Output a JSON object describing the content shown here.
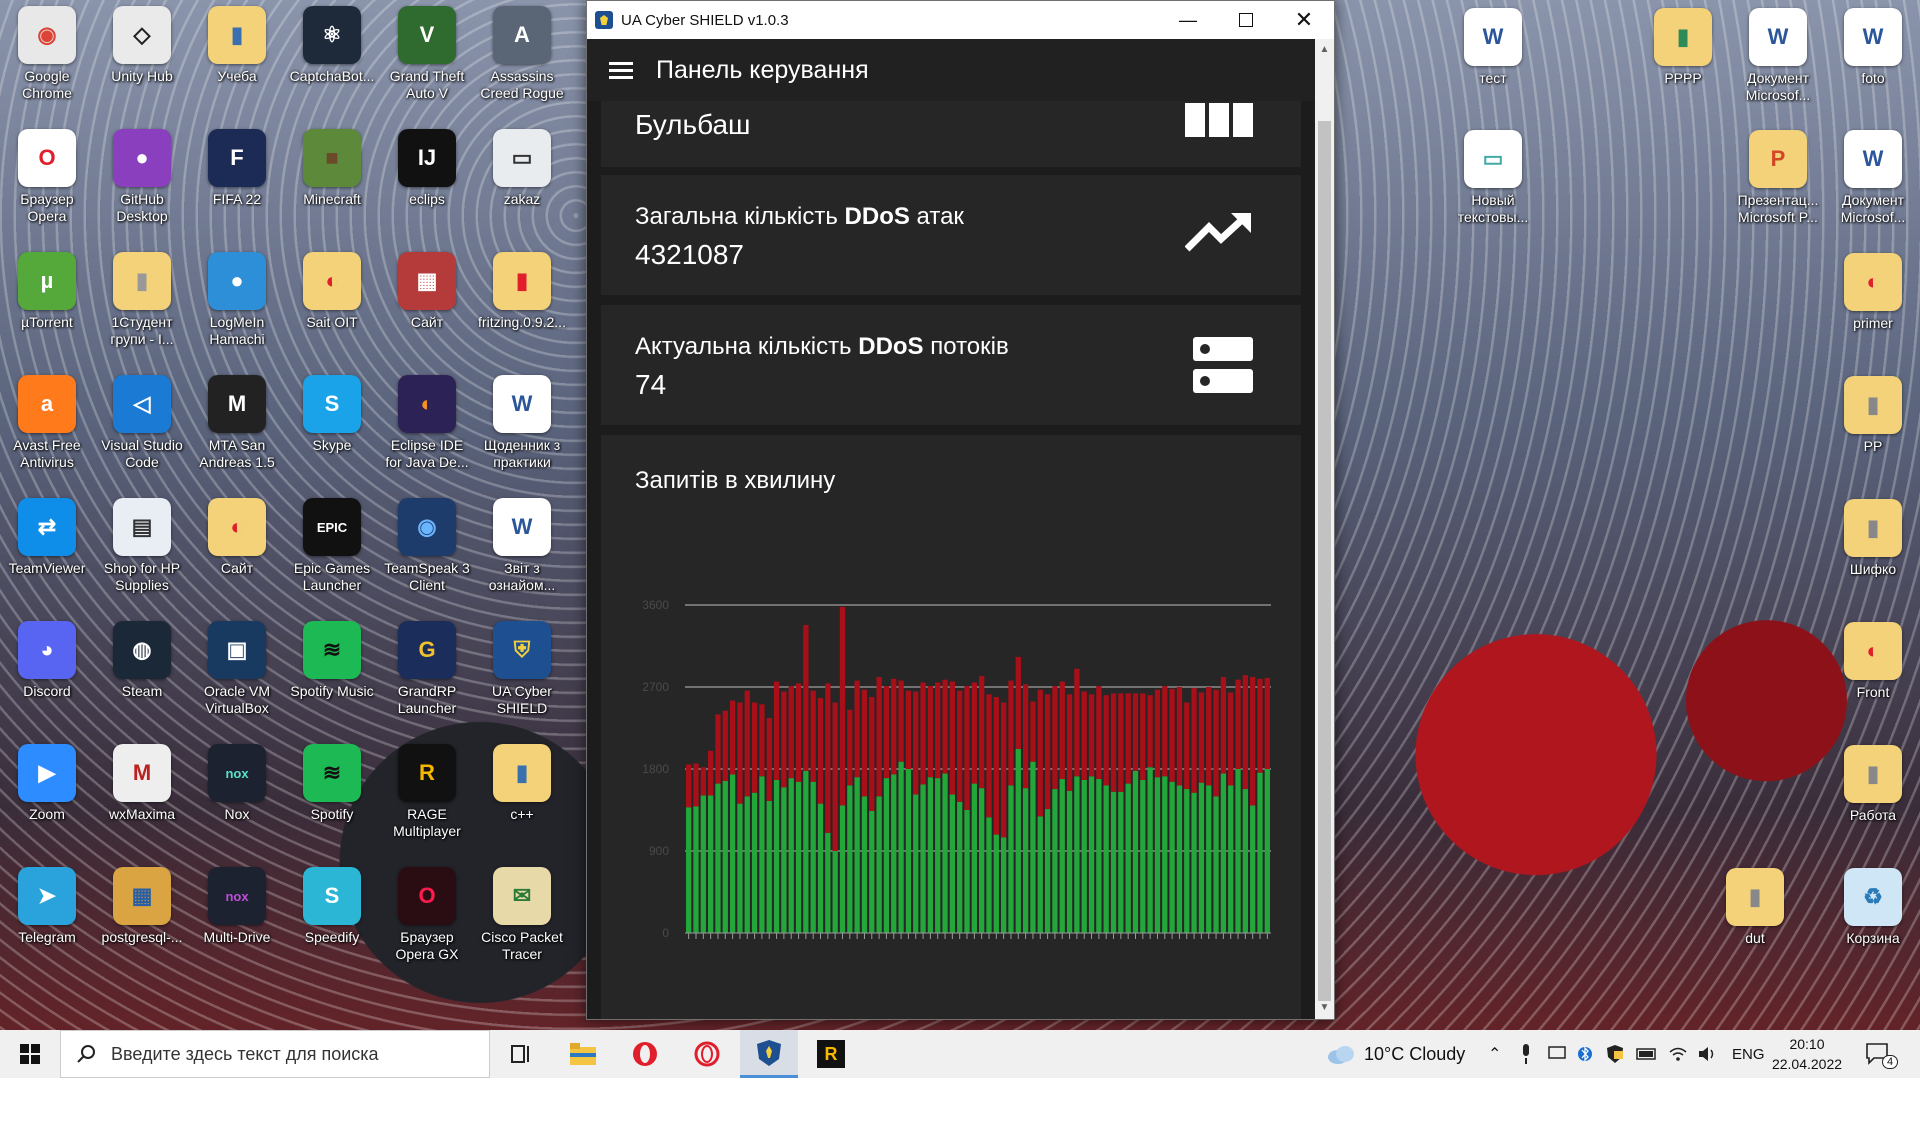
{
  "desktop": {
    "icons": [
      {
        "label": "Google Chrome",
        "col": 0,
        "row": 0,
        "color": "#e8e8e8",
        "glyph": "◉",
        "fg": "#db4437"
      },
      {
        "label": "Unity Hub",
        "col": 1,
        "row": 0,
        "color": "#eaeaea",
        "glyph": "◇",
        "fg": "#222"
      },
      {
        "label": "Учеба",
        "col": 2,
        "row": 0,
        "color": "#f3d27a",
        "glyph": "▮",
        "fg": "#3a6fb0"
      },
      {
        "label": "CaptchaBot...",
        "col": 3,
        "row": 0,
        "color": "#1e2a3a",
        "glyph": "⚛",
        "fg": "#fff"
      },
      {
        "label": "Grand Theft Auto V",
        "col": 4,
        "row": 0,
        "color": "#2f6a2f",
        "glyph": "V",
        "fg": "#fff"
      },
      {
        "label": "Assassins Creed Rogue",
        "col": 5,
        "row": 0,
        "color": "#5a6675",
        "glyph": "A",
        "fg": "#fff"
      },
      {
        "label": "Браузер Opera",
        "col": 0,
        "row": 1,
        "color": "#fff",
        "glyph": "O",
        "fg": "#e01e2c"
      },
      {
        "label": "GitHub Desktop",
        "col": 1,
        "row": 1,
        "color": "#8a3fbf",
        "glyph": "●",
        "fg": "#fff"
      },
      {
        "label": "FIFA 22",
        "col": 2,
        "row": 1,
        "color": "#1b2b55",
        "glyph": "F",
        "fg": "#fff"
      },
      {
        "label": "Minecraft",
        "col": 3,
        "row": 1,
        "color": "#5c8a3a",
        "glyph": "■",
        "fg": "#6b4a2a"
      },
      {
        "label": "eclips",
        "col": 4,
        "row": 1,
        "color": "#111",
        "glyph": "IJ",
        "fg": "#fff"
      },
      {
        "label": "zakaz",
        "col": 5,
        "row": 1,
        "color": "#e9ecef",
        "glyph": "▭",
        "fg": "#333"
      },
      {
        "label": "µTorrent",
        "col": 0,
        "row": 2,
        "color": "#55a83a",
        "glyph": "µ",
        "fg": "#fff"
      },
      {
        "label": "1Студент групи - I...",
        "col": 1,
        "row": 2,
        "color": "#f3d27a",
        "glyph": "▮",
        "fg": "#999"
      },
      {
        "label": "LogMeIn Hamachi",
        "col": 2,
        "row": 2,
        "color": "#2c8fd8",
        "glyph": "●",
        "fg": "#fff"
      },
      {
        "label": "Sait OIT",
        "col": 3,
        "row": 2,
        "color": "#f3d27a",
        "glyph": "◐",
        "fg": "#e01e2c"
      },
      {
        "label": "Сайт",
        "col": 4,
        "row": 2,
        "color": "#b53a3a",
        "glyph": "▦",
        "fg": "#fff"
      },
      {
        "label": "fritzing.0.9.2...",
        "col": 5,
        "row": 2,
        "color": "#f3d27a",
        "glyph": "▮",
        "fg": "#e01e2c"
      },
      {
        "label": "Avast Free Antivirus",
        "col": 0,
        "row": 3,
        "color": "#ff7a1a",
        "glyph": "a",
        "fg": "#fff"
      },
      {
        "label": "Visual Studio Code",
        "col": 1,
        "row": 3,
        "color": "#1a7ad4",
        "glyph": "◁",
        "fg": "#fff"
      },
      {
        "label": "MTA San Andreas 1.5",
        "col": 2,
        "row": 3,
        "color": "#222",
        "glyph": "M",
        "fg": "#fff"
      },
      {
        "label": "Skype",
        "col": 3,
        "row": 3,
        "color": "#1aa3e8",
        "glyph": "S",
        "fg": "#fff"
      },
      {
        "label": "Eclipse IDE for Java De...",
        "col": 4,
        "row": 3,
        "color": "#2c2255",
        "glyph": "◐",
        "fg": "#f7941e"
      },
      {
        "label": "Щоденник з практики",
        "col": 5,
        "row": 3,
        "color": "#fff",
        "glyph": "W",
        "fg": "#2b579a"
      },
      {
        "label": "TeamViewer",
        "col": 0,
        "row": 4,
        "color": "#0e8ee9",
        "glyph": "⇄",
        "fg": "#fff"
      },
      {
        "label": "Shop for HP Supplies",
        "col": 1,
        "row": 4,
        "color": "#e9eef5",
        "glyph": "▤",
        "fg": "#333"
      },
      {
        "label": "Сайт",
        "col": 2,
        "row": 4,
        "color": "#f3d27a",
        "glyph": "◐",
        "fg": "#e01e2c"
      },
      {
        "label": "Epic Games Launcher",
        "col": 3,
        "row": 4,
        "color": "#111",
        "glyph": "EPIC",
        "fg": "#fff"
      },
      {
        "label": "TeamSpeak 3 Client",
        "col": 4,
        "row": 4,
        "color": "#1d3b6b",
        "glyph": "◉",
        "fg": "#6bb5ff"
      },
      {
        "label": "Звіт з ознайом...",
        "col": 5,
        "row": 4,
        "color": "#fff",
        "glyph": "W",
        "fg": "#2b579a"
      },
      {
        "label": "Discord",
        "col": 0,
        "row": 5,
        "color": "#5865f2",
        "glyph": "◕",
        "fg": "#fff"
      },
      {
        "label": "Steam",
        "col": 1,
        "row": 5,
        "color": "#1b2838",
        "glyph": "◍",
        "fg": "#fff"
      },
      {
        "label": "Oracle VM VirtualBox",
        "col": 2,
        "row": 5,
        "color": "#183a61",
        "glyph": "▣",
        "fg": "#fff"
      },
      {
        "label": "Spotify Music",
        "col": 3,
        "row": 5,
        "color": "#1db954",
        "glyph": "≋",
        "fg": "#111"
      },
      {
        "label": "GrandRP Launcher",
        "col": 4,
        "row": 5,
        "color": "#1b2d5a",
        "glyph": "G",
        "fg": "#f2c12e"
      },
      {
        "label": "UA Cyber SHIELD",
        "col": 5,
        "row": 5,
        "color": "#1d4f91",
        "glyph": "⛨",
        "fg": "#f4d03f"
      },
      {
        "label": "Zoom",
        "col": 0,
        "row": 6,
        "color": "#2d8cff",
        "glyph": "▶",
        "fg": "#fff"
      },
      {
        "label": "wxMaxima",
        "col": 1,
        "row": 6,
        "color": "#eee",
        "glyph": "M",
        "fg": "#b22"
      },
      {
        "label": "Nox",
        "col": 2,
        "row": 6,
        "color": "#1c2230",
        "glyph": "nox",
        "fg": "#5ae0c9"
      },
      {
        "label": "Spotify",
        "col": 3,
        "row": 6,
        "color": "#1db954",
        "glyph": "≋",
        "fg": "#111"
      },
      {
        "label": "RAGE Multiplayer",
        "col": 4,
        "row": 6,
        "color": "#111",
        "glyph": "R",
        "fg": "#f5b700"
      },
      {
        "label": "c++",
        "col": 5,
        "row": 6,
        "color": "#f3d27a",
        "glyph": "▮",
        "fg": "#3a6fb0"
      },
      {
        "label": "Telegram",
        "col": 0,
        "row": 7,
        "color": "#2aa3dd",
        "glyph": "➤",
        "fg": "#fff"
      },
      {
        "label": "postgresql-...",
        "col": 1,
        "row": 7,
        "color": "#d9a441",
        "glyph": "▦",
        "fg": "#2b5fa4"
      },
      {
        "label": "Multi-Drive",
        "col": 2,
        "row": 7,
        "color": "#1c2230",
        "glyph": "nox",
        "fg": "#c04dd8"
      },
      {
        "label": "Speedify",
        "col": 3,
        "row": 7,
        "color": "#2bb6d6",
        "glyph": "S",
        "fg": "#fff"
      },
      {
        "label": "Браузер Opera GX",
        "col": 4,
        "row": 7,
        "color": "#2a0d12",
        "glyph": "O",
        "fg": "#ff1b4b"
      },
      {
        "label": "Cisco Packet Tracer",
        "col": 5,
        "row": 7,
        "color": "#e8d9a8",
        "glyph": "✉",
        "fg": "#2a7a3a"
      }
    ],
    "right_icons": [
      {
        "label": "тест",
        "x": 1448,
        "y": 8,
        "color": "#fff",
        "glyph": "W",
        "fg": "#2b579a"
      },
      {
        "label": "РРРР",
        "x": 1638,
        "y": 8,
        "color": "#f3d27a",
        "glyph": "▮",
        "fg": "#2e8b57"
      },
      {
        "label": "Документ Microsof...",
        "x": 1733,
        "y": 8,
        "color": "#fff",
        "glyph": "W",
        "fg": "#2b579a"
      },
      {
        "label": "foto",
        "x": 1828,
        "y": 8,
        "color": "#fff",
        "glyph": "W",
        "fg": "#2b579a"
      },
      {
        "label": "Новый текстовы...",
        "x": 1448,
        "y": 130,
        "color": "#fff",
        "glyph": "▭",
        "fg": "#4aa"
      },
      {
        "label": "Презентац... Microsoft P...",
        "x": 1733,
        "y": 130,
        "color": "#f3d27a",
        "glyph": "P",
        "fg": "#d24726"
      },
      {
        "label": "Документ Microsof...",
        "x": 1828,
        "y": 130,
        "color": "#fff",
        "glyph": "W",
        "fg": "#2b579a"
      },
      {
        "label": "primer",
        "x": 1828,
        "y": 253,
        "color": "#f3d27a",
        "glyph": "◐",
        "fg": "#e01e2c"
      },
      {
        "label": "РР",
        "x": 1828,
        "y": 376,
        "color": "#f3d27a",
        "glyph": "▮",
        "fg": "#888"
      },
      {
        "label": "Шифко",
        "x": 1828,
        "y": 499,
        "color": "#f3d27a",
        "glyph": "▮",
        "fg": "#888"
      },
      {
        "label": "Front",
        "x": 1828,
        "y": 622,
        "color": "#f3d27a",
        "glyph": "◐",
        "fg": "#e01e2c"
      },
      {
        "label": "Работа",
        "x": 1828,
        "y": 745,
        "color": "#f3d27a",
        "glyph": "▮",
        "fg": "#888"
      },
      {
        "label": "dut",
        "x": 1710,
        "y": 868,
        "color": "#f3d27a",
        "glyph": "▮",
        "fg": "#888"
      },
      {
        "label": "Корзина",
        "x": 1828,
        "y": 868,
        "color": "#cfe6f7",
        "glyph": "♻",
        "fg": "#2a7ab8"
      }
    ]
  },
  "window": {
    "title": "UA Cyber SHIELD v1.0.3",
    "appbar_title": "Панель керування",
    "cards": {
      "name": "Бульбаш",
      "total_label_pre": "Загальна кількість ",
      "total_label_bold": "DDoS",
      "total_label_post": " атак",
      "total_value": "4321087",
      "streams_label_pre": "Актуальна кількість ",
      "streams_label_bold": "DDoS",
      "streams_label_post": " потоків",
      "streams_value": "74",
      "chart_title": "Запитів в хвилину"
    }
  },
  "chart_data": {
    "type": "bar",
    "title": "Запитів в хвилину",
    "stacked": true,
    "ylim": [
      0,
      3600
    ],
    "yticks": [
      "0",
      "900",
      "1800",
      "2700",
      "3600"
    ],
    "grid": true,
    "series": [
      {
        "color": "#23a73b",
        "values": [
          1380,
          1390,
          1510,
          1510,
          1640,
          1670,
          1740,
          1420,
          1500,
          1540,
          1720,
          1450,
          1680,
          1600,
          1700,
          1660,
          1780,
          1660,
          1420,
          1100,
          900,
          1400,
          1620,
          1710,
          1500,
          1340,
          1500,
          1700,
          1740,
          1880,
          1800,
          1520,
          1630,
          1710,
          1700,
          1750,
          1520,
          1440,
          1350,
          1640,
          1590,
          1270,
          1080,
          1050,
          1620,
          2020,
          1590,
          1880,
          1280,
          1360,
          1580,
          1690,
          1560,
          1720,
          1680,
          1720,
          1690,
          1620,
          1550,
          1550,
          1640,
          1780,
          1680,
          1820,
          1710,
          1720,
          1660,
          1620,
          1580,
          1540,
          1650,
          1620,
          1500,
          1750,
          1620,
          1800,
          1580,
          1400,
          1760,
          1800
        ]
      },
      {
        "color": "#a80f19",
        "values": [
          470,
          470,
          310,
          490,
          760,
          770,
          810,
          1110,
          1160,
          990,
          790,
          910,
          1080,
          1050,
          1010,
          1080,
          1600,
          1000,
          1160,
          1640,
          1630,
          2180,
          830,
          1060,
          1170,
          1250,
          1310,
          1010,
          1050,
          890,
          860,
          1130,
          1120,
          1000,
          1050,
          1030,
          1240,
          1220,
          1360,
          1110,
          1230,
          1350,
          1510,
          1480,
          1150,
          1010,
          1140,
          660,
          1390,
          1260,
          1130,
          1070,
          1060,
          1180,
          970,
          900,
          1020,
          990,
          1080,
          1080,
          990,
          850,
          950,
          790,
          960,
          990,
          1020,
          1080,
          950,
          1150,
          990,
          1080,
          1170,
          1060,
          1020,
          980,
          1250,
          1410,
          1030,
          1000
        ]
      }
    ]
  },
  "taskbar": {
    "search_placeholder": "Введите здесь текст для поиска",
    "weather": "10°C  Cloudy",
    "lang": "ENG",
    "time": "20:10",
    "date": "22.04.2022",
    "notif_count": "4"
  }
}
